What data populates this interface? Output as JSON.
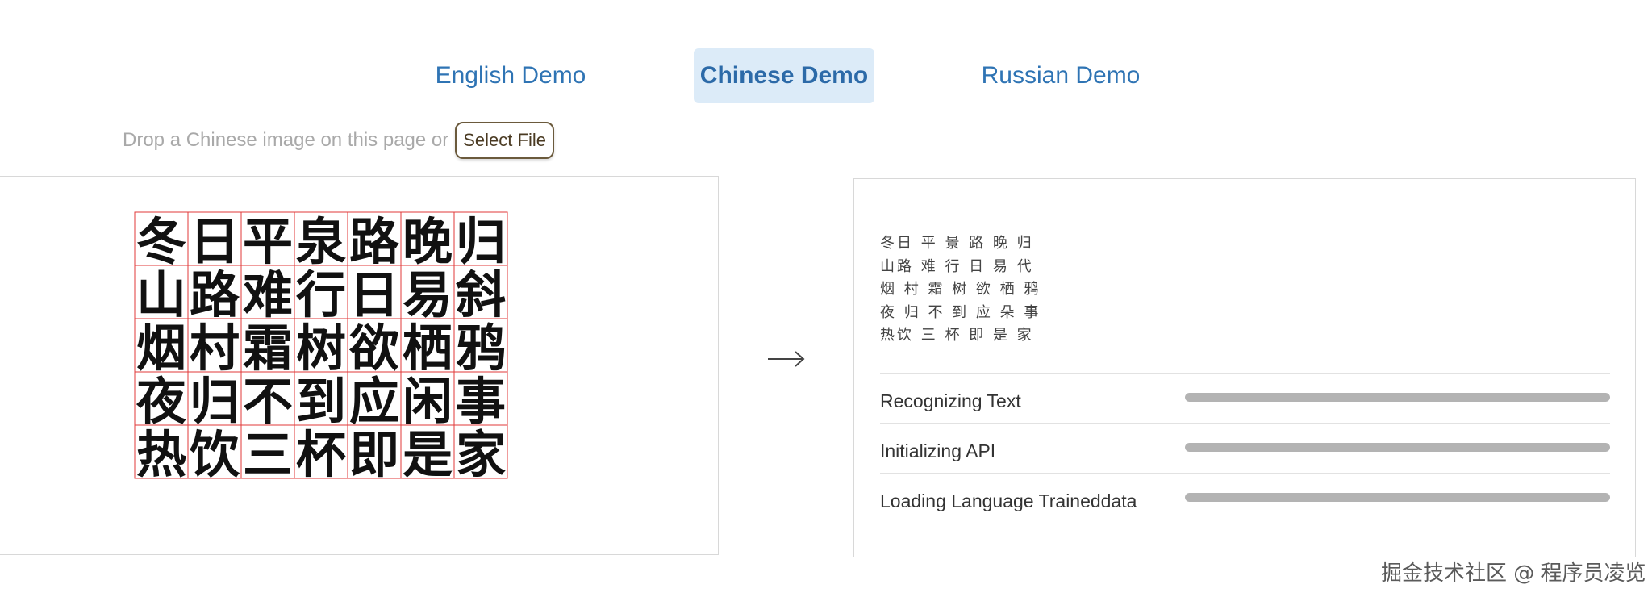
{
  "tabs": [
    {
      "label": "English Demo",
      "active": false
    },
    {
      "label": "Chinese Demo",
      "active": true
    },
    {
      "label": "Russian Demo",
      "active": false
    }
  ],
  "drop": {
    "text": "Drop a Chinese image on this page or",
    "button_label": "Select File"
  },
  "source_image": {
    "lines": [
      "冬日平泉路晚归",
      "山路难行日易斜",
      "烟村霜树欲栖鸦",
      "夜归不到应闲事",
      "热饮三杯即是家"
    ]
  },
  "arrow_icon": "right-arrow-icon",
  "result": {
    "text_lines": [
      "冬日 平 景 路 晚 归",
      "山路 难 行 日 易 代",
      "烟 村 霜 树 欲 栖 鸦",
      "夜 归 不 到 应 朵 事",
      "热饮 三 杯 即 是 家"
    ],
    "status": [
      {
        "label": "Recognizing Text",
        "progress": 1.0
      },
      {
        "label": "Initializing API",
        "progress": 1.0
      },
      {
        "label": "Loading Language Traineddata",
        "progress": 1.0
      }
    ]
  },
  "watermark": "掘金技术社区 @ 程序员凌览",
  "colors": {
    "tab_text": "#2f74b4",
    "tab_active_bg": "#dcebf8",
    "box_outline": "#e03a3a",
    "progress_fill": "#b3b3b3"
  }
}
